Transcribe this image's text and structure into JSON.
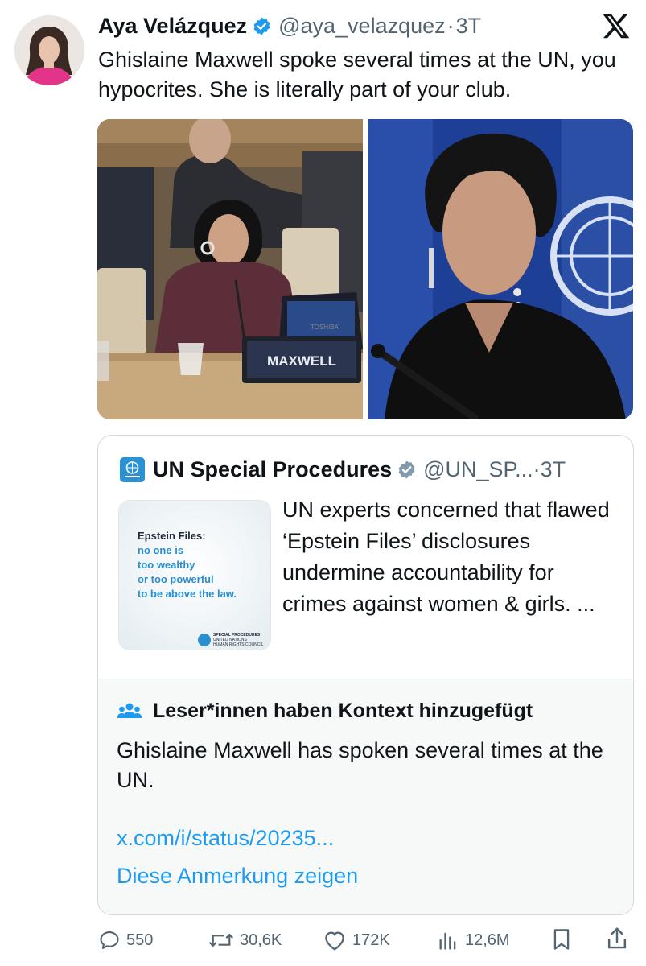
{
  "post": {
    "author_name": "Aya Velázquez",
    "handle": "@aya_velazquez",
    "separator": "·",
    "time": "3T",
    "text": "Ghislaine Maxwell spoke several times at the UN, you hypocrites. She is literally part of your club.",
    "photo_left_nameplate": "MAXWELL",
    "photo_left_laptop_brand": "TOSHIBA"
  },
  "quote": {
    "author_name": "UN Special Procedures",
    "handle": "@UN_SP...",
    "separator": "·",
    "time": "3T",
    "text": "UN experts concerned that flawed ‘Epstein Files’ disclosures undermine accountability for crimes against women & girls. ...",
    "thumb": {
      "heading": "Epstein Files:",
      "line1": "no one is",
      "line2": "too wealthy",
      "line3": "or too powerful",
      "line4": "to be above the law.",
      "org1": "SPECIAL PROCEDURES",
      "org2": "UNITED NATIONS",
      "org3": "HUMAN RIGHTS COUNCIL"
    }
  },
  "community_note": {
    "title": "Leser*innen haben Kontext hinzugefügt",
    "body": "Ghislaine Maxwell has spoken several times at the UN.",
    "link": "x.com/i/status/20235...",
    "show_label": "Diese Anmerkung zeigen"
  },
  "actions": {
    "replies": "550",
    "reposts": "30,6K",
    "likes": "172K",
    "views": "12,6M"
  },
  "colors": {
    "accent": "#1d9bf0",
    "muted": "#536471",
    "border": "#cfd9de"
  }
}
